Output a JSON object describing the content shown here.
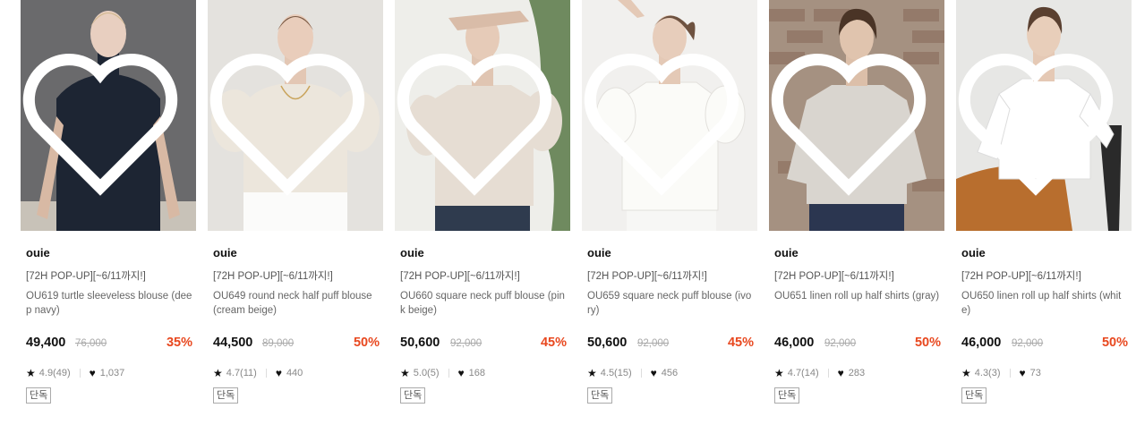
{
  "products": [
    {
      "brand": "ouie",
      "promo": "[72H POP-UP][~6/11까지!]",
      "name": "OU619 turtle sleeveless blouse (deep navy)",
      "price": "49,400",
      "original_price": "76,000",
      "discount": "35%",
      "rating": "4.9(49)",
      "likes": "1,037",
      "badge": "단독",
      "bg_color": "#6a6a6c",
      "top_color": "#1d2533"
    },
    {
      "brand": "ouie",
      "promo": "[72H POP-UP][~6/11까지!]",
      "name": "OU649 round neck half puff blouse (cream beige)",
      "price": "44,500",
      "original_price": "89,000",
      "discount": "50%",
      "rating": "4.7(11)",
      "likes": "440",
      "badge": "단독",
      "bg_color": "#e4e2de",
      "top_color": "#ece6dc"
    },
    {
      "brand": "ouie",
      "promo": "[72H POP-UP][~6/11까지!]",
      "name": "OU660 square neck puff blouse (pink beige)",
      "price": "50,600",
      "original_price": "92,000",
      "discount": "45%",
      "rating": "5.0(5)",
      "likes": "168",
      "badge": "단독",
      "bg_color": "#eeeeea",
      "top_color": "#e6ddd3"
    },
    {
      "brand": "ouie",
      "promo": "[72H POP-UP][~6/11까지!]",
      "name": "OU659 square neck puff blouse (ivory)",
      "price": "50,600",
      "original_price": "92,000",
      "discount": "45%",
      "rating": "4.5(15)",
      "likes": "456",
      "badge": "단독",
      "bg_color": "#f1f0ee",
      "top_color": "#fbfbf8"
    },
    {
      "brand": "ouie",
      "promo": "[72H POP-UP][~6/11까지!]",
      "name": "OU651 linen roll up half shirts (gray)",
      "price": "46,000",
      "original_price": "92,000",
      "discount": "50%",
      "rating": "4.7(14)",
      "likes": "283",
      "badge": "단독",
      "bg_color": "#a59181",
      "top_color": "#d9d5cf"
    },
    {
      "brand": "ouie",
      "promo": "[72H POP-UP][~6/11까지!]",
      "name": "OU650 linen roll up half shirts (white)",
      "price": "46,000",
      "original_price": "92,000",
      "discount": "50%",
      "rating": "4.3(3)",
      "likes": "73",
      "badge": "단독",
      "bg_color": "#e7e7e5",
      "top_color": "#ffffff"
    }
  ],
  "icons": {
    "wishlist": "heart-outline-icon",
    "rating": "star-icon",
    "likes": "heart-icon"
  },
  "colors": {
    "discount": "#e8481f",
    "text": "#222222",
    "muted": "#888888"
  }
}
